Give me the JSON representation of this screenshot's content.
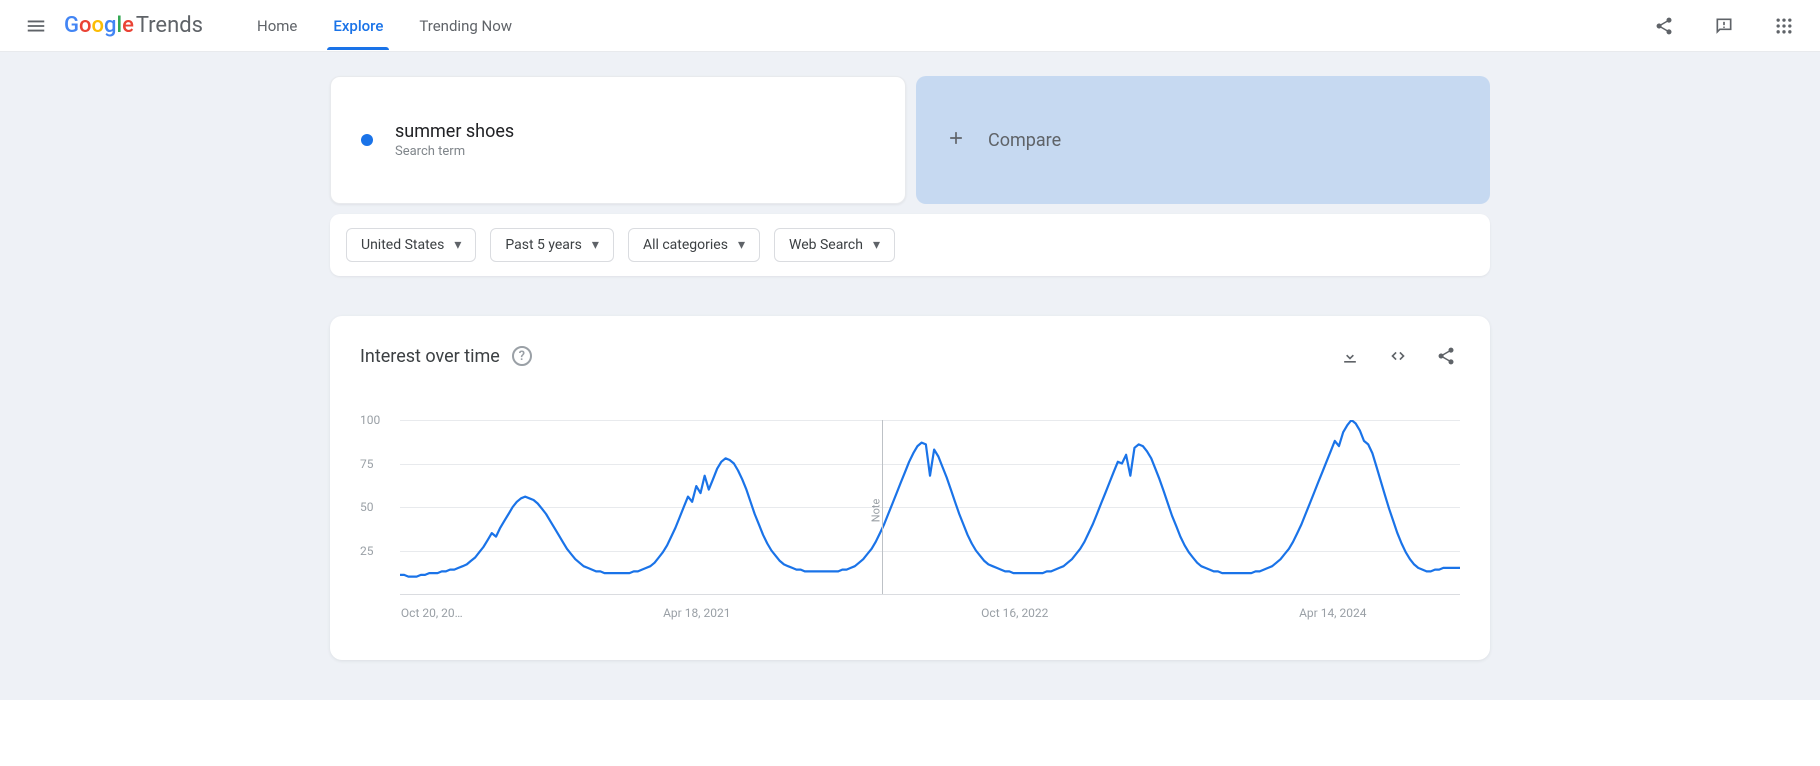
{
  "header": {
    "logo_brand": "Google",
    "logo_product": "Trends",
    "nav": {
      "home": "Home",
      "explore": "Explore",
      "trending": "Trending Now"
    }
  },
  "pills": {
    "term": "summer shoes",
    "term_sub": "Search term",
    "compare": "Compare"
  },
  "filters": {
    "geo": "United States",
    "time": "Past 5 years",
    "category": "All categories",
    "property": "Web Search"
  },
  "chart": {
    "title": "Interest over time",
    "note_label": "Note"
  },
  "chart_data": {
    "type": "line",
    "title": "Interest over time",
    "xlabel": "",
    "ylabel": "",
    "ylim": [
      0,
      100
    ],
    "y_ticks": [
      25,
      50,
      75,
      100
    ],
    "x_tick_labels": [
      "Oct 20, 20…",
      "Apr 18, 2021",
      "Oct 16, 2022",
      "Apr 14, 2024"
    ],
    "x_tick_positions_pct": [
      3,
      28,
      58,
      88
    ],
    "cursor_pct": 45.5,
    "series": [
      {
        "name": "summer shoes",
        "color": "#1a73e8",
        "values": [
          11,
          11,
          10,
          10,
          10,
          11,
          11,
          12,
          12,
          12,
          13,
          13,
          14,
          14,
          15,
          16,
          17,
          19,
          21,
          24,
          27,
          31,
          35,
          33,
          38,
          42,
          46,
          50,
          53,
          55,
          56,
          55,
          54,
          52,
          49,
          46,
          42,
          38,
          34,
          30,
          26,
          23,
          20,
          18,
          16,
          15,
          14,
          13,
          13,
          12,
          12,
          12,
          12,
          12,
          12,
          12,
          13,
          13,
          14,
          15,
          16,
          18,
          21,
          24,
          28,
          33,
          38,
          44,
          50,
          56,
          53,
          62,
          58,
          68,
          60,
          66,
          72,
          76,
          78,
          77,
          75,
          71,
          66,
          60,
          53,
          46,
          40,
          34,
          29,
          25,
          22,
          19,
          17,
          16,
          15,
          14,
          14,
          13,
          13,
          13,
          13,
          13,
          13,
          13,
          13,
          13,
          14,
          14,
          15,
          16,
          18,
          20,
          23,
          26,
          30,
          35,
          40,
          46,
          52,
          58,
          64,
          70,
          76,
          81,
          85,
          87,
          86,
          68,
          83,
          79,
          73,
          67,
          60,
          53,
          46,
          40,
          34,
          29,
          25,
          22,
          19,
          17,
          16,
          15,
          14,
          13,
          13,
          12,
          12,
          12,
          12,
          12,
          12,
          12,
          12,
          13,
          13,
          14,
          15,
          16,
          18,
          20,
          23,
          26,
          30,
          35,
          40,
          46,
          52,
          58,
          64,
          70,
          76,
          75,
          80,
          68,
          84,
          86,
          85,
          82,
          78,
          72,
          66,
          59,
          52,
          45,
          39,
          33,
          28,
          24,
          21,
          18,
          16,
          15,
          14,
          13,
          13,
          12,
          12,
          12,
          12,
          12,
          12,
          12,
          12,
          13,
          13,
          14,
          15,
          16,
          18,
          20,
          23,
          26,
          30,
          35,
          40,
          46,
          52,
          58,
          64,
          70,
          76,
          82,
          88,
          85,
          93,
          97,
          100,
          98,
          94,
          88,
          86,
          81,
          73,
          65,
          57,
          49,
          42,
          35,
          29,
          24,
          20,
          17,
          15,
          14,
          13,
          13,
          14,
          14,
          15,
          15,
          15,
          15,
          15
        ]
      }
    ]
  }
}
